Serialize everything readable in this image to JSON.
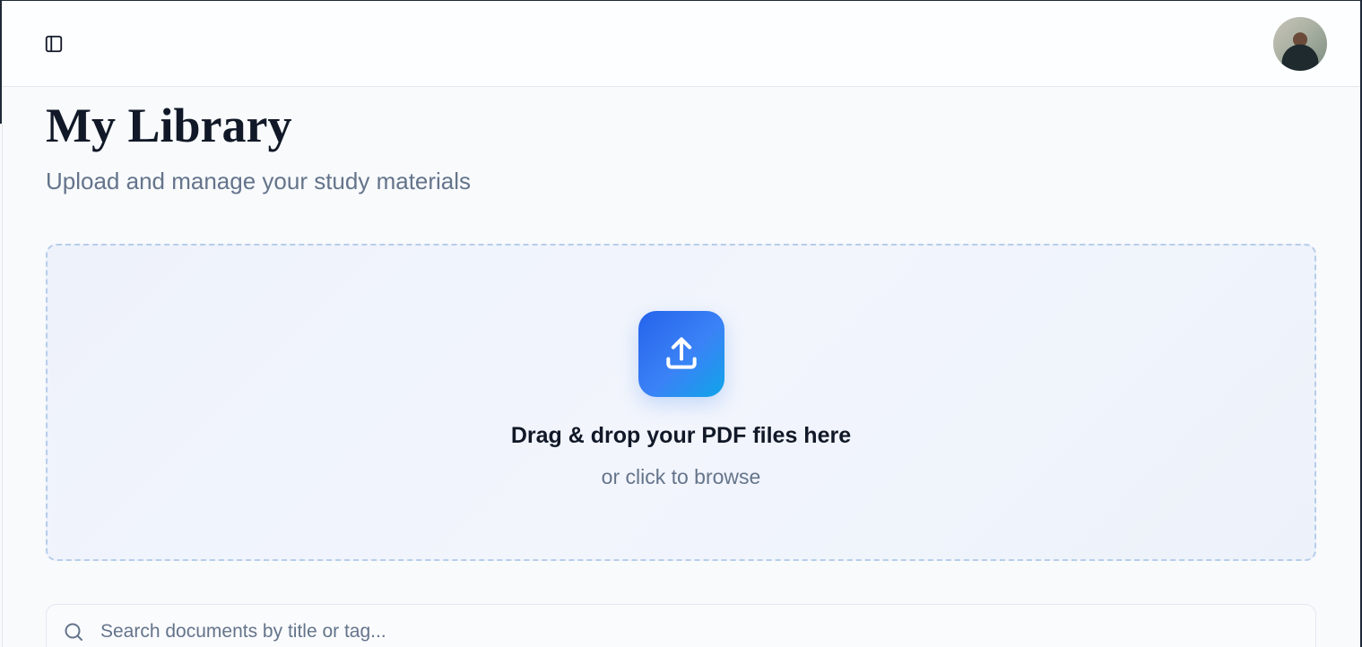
{
  "header": {
    "sidebar_toggle_icon": "sidebar-panel-icon",
    "avatar_icon": "user-avatar"
  },
  "page": {
    "title": "My Library",
    "subtitle": "Upload and manage your study materials"
  },
  "dropzone": {
    "icon": "upload-icon",
    "title": "Drag & drop your PDF files here",
    "subtitle": "or click to browse"
  },
  "search": {
    "icon": "search-icon",
    "placeholder": "Search documents by title or tag...",
    "value": ""
  },
  "colors": {
    "accent_start": "#2563eb",
    "accent_end": "#0ea5e9",
    "heading": "#111827",
    "muted_text": "#64748b",
    "dropzone_border": "#b7cdeb",
    "background": "#f8fafc"
  }
}
